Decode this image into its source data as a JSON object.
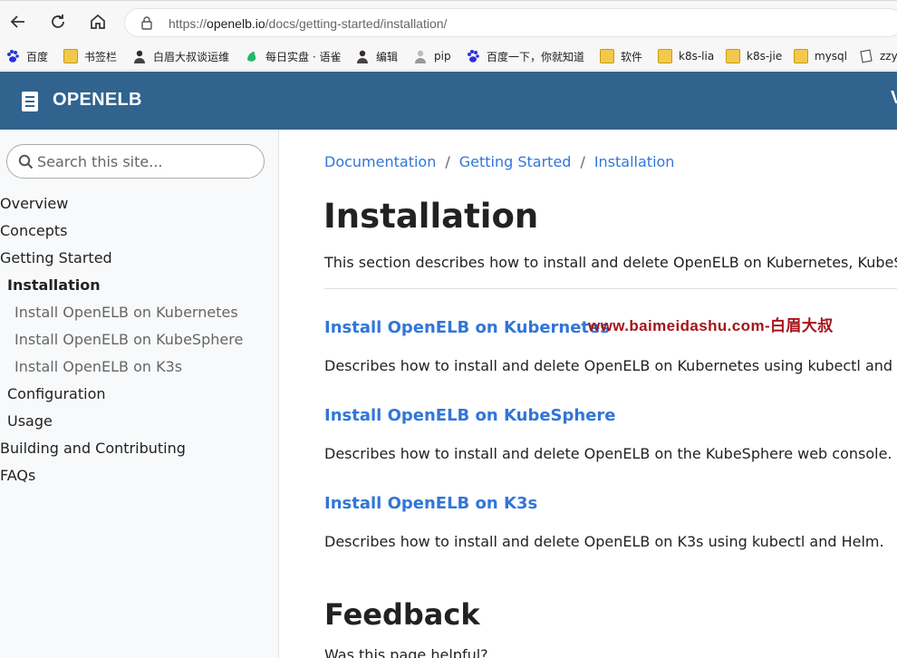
{
  "browser": {
    "url_prefix": "https://",
    "url_host": "openelb.io",
    "url_path": "/docs/getting-started/installation/"
  },
  "bookmarks": [
    {
      "label": "百度",
      "icon": "baidu-paw-icon"
    },
    {
      "label": "书签栏",
      "icon": "folder-icon"
    },
    {
      "label": "白眉大叔谈运维",
      "icon": "person-avatar-icon"
    },
    {
      "label": "每日实盘 · 语雀",
      "icon": "yuque-icon"
    },
    {
      "label": "编辑",
      "icon": "person-avatar-icon"
    },
    {
      "label": "pip",
      "icon": "person-icon"
    },
    {
      "label": "百度一下，你就知道",
      "icon": "baidu-paw-icon"
    },
    {
      "label": "软件",
      "icon": "folder-icon"
    },
    {
      "label": "k8s-lia",
      "icon": "folder-icon"
    },
    {
      "label": "k8s-jie",
      "icon": "folder-icon"
    },
    {
      "label": "mysql",
      "icon": "folder-icon"
    },
    {
      "label": "zzy",
      "icon": "page-icon"
    }
  ],
  "header": {
    "brand": "OPENELB",
    "edge_text": "V",
    "color": "#30638e"
  },
  "sidebar": {
    "search_placeholder": "Search this site...",
    "items": [
      {
        "label": "Overview"
      },
      {
        "label": "Concepts"
      },
      {
        "label": "Getting Started"
      },
      {
        "label": "Installation"
      },
      {
        "label": "Install OpenELB on Kubernetes"
      },
      {
        "label": "Install OpenELB on KubeSphere"
      },
      {
        "label": "Install OpenELB on K3s"
      },
      {
        "label": "Configuration"
      },
      {
        "label": "Usage"
      },
      {
        "label": "Building and Contributing"
      },
      {
        "label": "FAQs"
      }
    ]
  },
  "main": {
    "breadcrumb": [
      "Documentation",
      "Getting Started",
      "Installation"
    ],
    "breadcrumb_sep": "/",
    "title": "Installation",
    "lead": "This section describes how to install and delete OpenELB on Kubernetes, KubeSphere",
    "sections": [
      {
        "title": "Install OpenELB on Kubernetes",
        "desc": "Describes how to install and delete OpenELB on Kubernetes using kubectl and Helm."
      },
      {
        "title": "Install OpenELB on KubeSphere",
        "desc": "Describes how to install and delete OpenELB on the KubeSphere web console."
      },
      {
        "title": "Install OpenELB on K3s",
        "desc": "Describes how to install and delete OpenELB on K3s using kubectl and Helm."
      }
    ],
    "watermark": "www.baimeidashu.com-白眉大叔",
    "feedback_title": "Feedback",
    "feedback_question": "Was this page helpful?",
    "link_color": "#3176d9"
  }
}
